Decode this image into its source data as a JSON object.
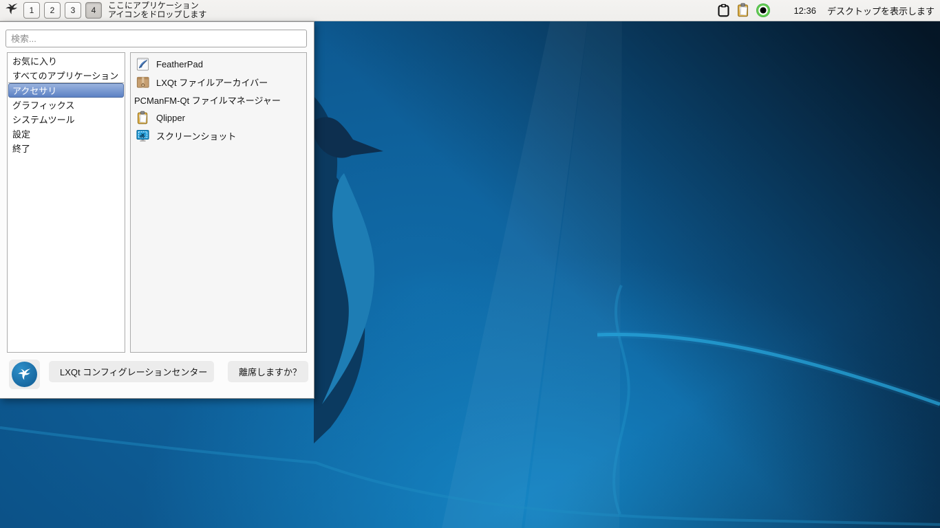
{
  "panel": {
    "workspaces": [
      "1",
      "2",
      "3",
      "4"
    ],
    "active_workspace": "4",
    "drop_hint": {
      "line1": "ここにアプリケーション",
      "line2": "アイコンをドロップします"
    },
    "clock": "12:36",
    "show_desktop_label": "デスクトップを表示します"
  },
  "menu": {
    "search": {
      "placeholder": "検索..."
    },
    "categories": [
      {
        "label": "お気に入り",
        "selected": false
      },
      {
        "label": "すべてのアプリケーション",
        "selected": false
      },
      {
        "label": "アクセサリ",
        "selected": true
      },
      {
        "label": "グラフィックス",
        "selected": false
      },
      {
        "label": "システムツール",
        "selected": false
      },
      {
        "label": "設定",
        "selected": false
      },
      {
        "label": "終了",
        "selected": false
      }
    ],
    "apps": [
      {
        "label": "FeatherPad",
        "icon": "featherpad-icon"
      },
      {
        "label": "LXQt ファイルアーカイバー",
        "icon": "archiver-icon"
      },
      {
        "label": "PCManFM-Qt ファイルマネージャー",
        "icon": "none"
      },
      {
        "label": "Qlipper",
        "icon": "qlipper-icon"
      },
      {
        "label": "スクリーンショット",
        "icon": "screenshot-icon"
      }
    ],
    "footer": {
      "config_button": "LXQt コンフィグレーションセンター",
      "leave_button": "離席しますか？"
    }
  },
  "colors": {
    "panel_bg": "#f1f0ee",
    "selection_top": "#9ab3de",
    "selection_bottom": "#5c81c4",
    "wallpaper_base": "#0c5288",
    "wallpaper_dark_bird": "#0d2f4f",
    "wallpaper_wing": "#1e7db4",
    "swoosh": "#27a5da",
    "logo_blue": "#1b6fa8"
  }
}
